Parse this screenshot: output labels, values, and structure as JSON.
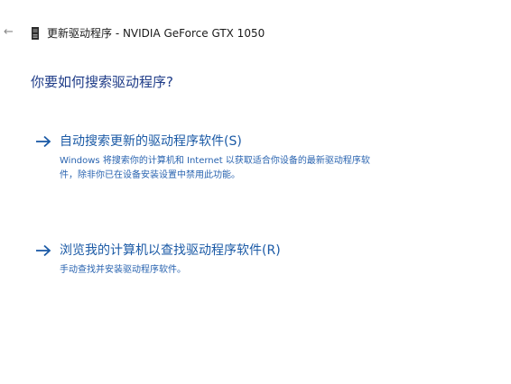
{
  "window": {
    "title": "更新驱动程序 - NVIDIA GeForce GTX 1050",
    "back_glyph": "←",
    "device_icon": "graphics-card-icon"
  },
  "main": {
    "heading": "你要如何搜索驱动程序?",
    "options": [
      {
        "title": "自动搜索更新的驱动程序软件(S)",
        "description_line1": "Windows 将搜索你的计算机和 Internet 以获取适合你设备的最新驱动程序软",
        "description_line2": "件，除非你已在设备安装设置中禁用此功能。",
        "icon": "arrow-right-icon"
      },
      {
        "title": "浏览我的计算机以查找驱动程序软件(R)",
        "description_line1": "手动查找并安装驱动程序软件。",
        "icon": "arrow-right-icon"
      }
    ]
  },
  "colors": {
    "heading": "#1f3c88",
    "link": "#1b5aa6",
    "description": "#2a64b0",
    "background": "#ffffff"
  }
}
